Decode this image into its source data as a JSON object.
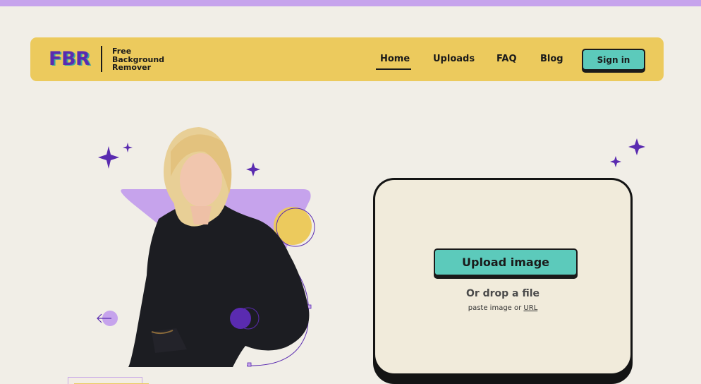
{
  "brand": {
    "logo": "FBR",
    "tagline": [
      "Free",
      "Background",
      "Remover"
    ]
  },
  "nav": {
    "home": "Home",
    "uploads": "Uploads",
    "faq": "FAQ",
    "blog": "Blog",
    "signin": "Sign in"
  },
  "upload": {
    "button_label": "Upload image",
    "drop_label": "Or drop a file",
    "paste_prefix": "paste image or",
    "url_label": "URL"
  },
  "colors": {
    "background": "#f1eee7",
    "top_strip": "#c6a3ec",
    "navbar": "#ecca5d",
    "accent_teal": "#5ccabb",
    "accent_purple": "#5a2bb0",
    "lavender": "#c6a3ec",
    "yellow": "#ecca5d"
  },
  "icons": {
    "hero_left_arrow": "arrow-left-icon",
    "sparkles": "sparkle-icon"
  }
}
